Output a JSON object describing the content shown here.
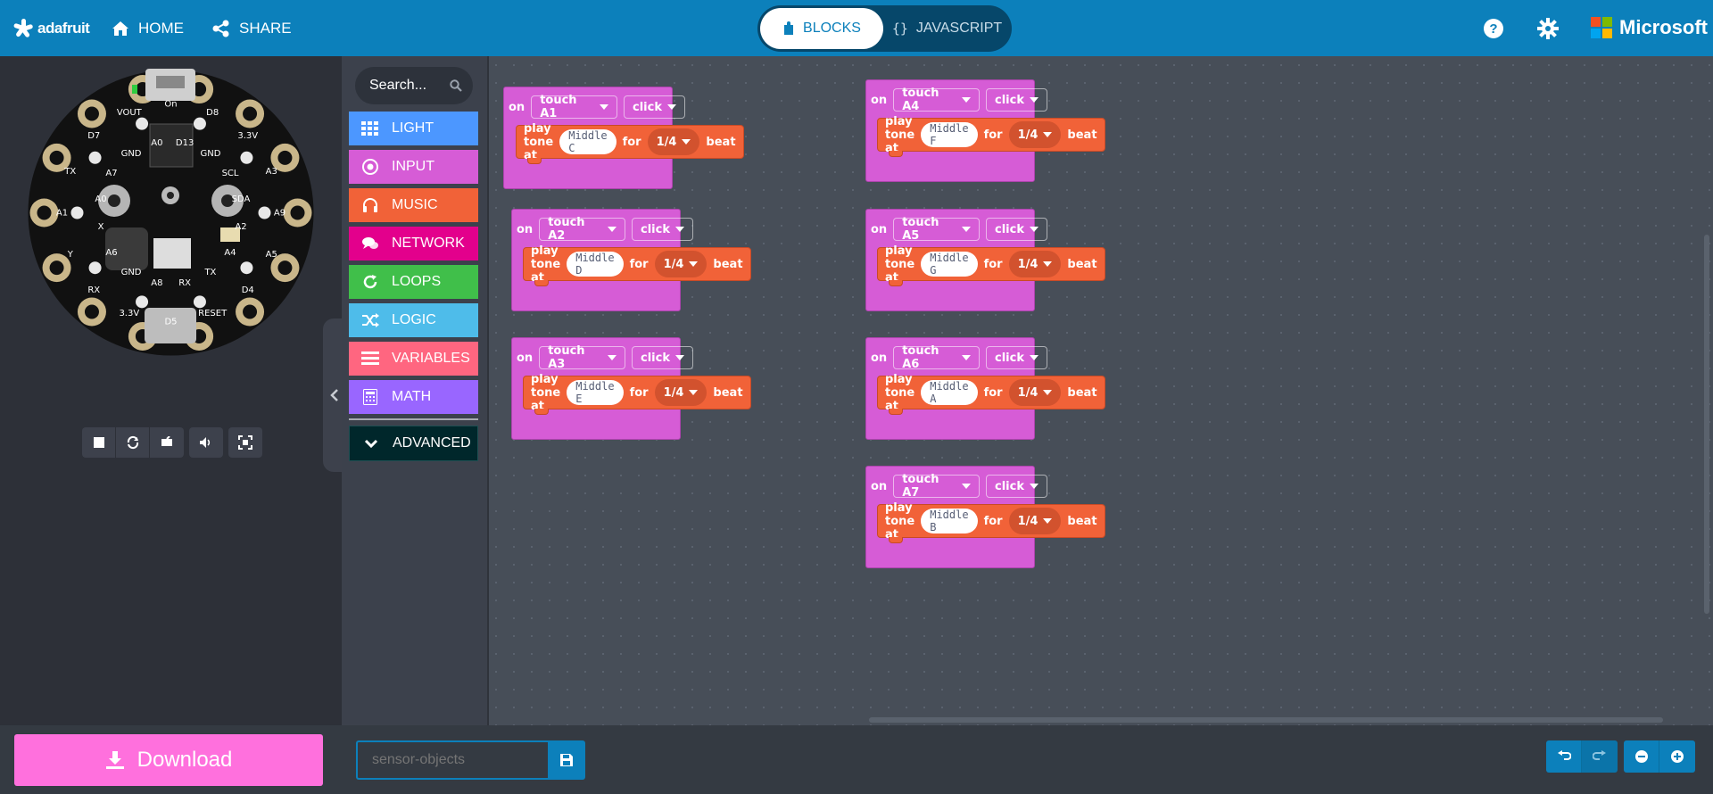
{
  "header": {
    "brand": "adafruit",
    "home_label": "HOME",
    "share_label": "SHARE",
    "blocks_label": "BLOCKS",
    "javascript_label": "JAVASCRIPT",
    "microsoft_label": "Microsoft",
    "accent_color": "#0c80bb"
  },
  "simulator": {
    "board_labels": [
      "On",
      "D13",
      "D8",
      "GND",
      "3.3V",
      "SCL",
      "A3",
      "SDA",
      "A9",
      "A2",
      "A5",
      "A4",
      "D4",
      "TX",
      "RESET",
      "RX",
      "D5",
      "A8",
      "3.3V",
      "GND",
      "RX",
      "A6",
      "Y",
      "X",
      "A1",
      "A0",
      "TX",
      "A7",
      "D7",
      "GND",
      "VOUT",
      "A0"
    ],
    "controls": [
      "stop-icon",
      "restart-icon",
      "debug-icon",
      "mute-icon",
      "fullscreen-icon"
    ]
  },
  "toolbox": {
    "search_placeholder": "Search...",
    "categories": [
      {
        "label": "LIGHT",
        "color": "#4c97ff",
        "icon": "grid-icon"
      },
      {
        "label": "INPUT",
        "color": "#d65cd6",
        "icon": "target-icon"
      },
      {
        "label": "MUSIC",
        "color": "#f16238",
        "icon": "headphones-icon"
      },
      {
        "label": "NETWORK",
        "color": "#e3008c",
        "icon": "chat-icon"
      },
      {
        "label": "LOOPS",
        "color": "#40bf4a",
        "icon": "refresh-icon"
      },
      {
        "label": "LOGIC",
        "color": "#4ebcea",
        "icon": "shuffle-icon"
      },
      {
        "label": "VARIABLES",
        "color": "#ff6680",
        "icon": "list-icon"
      },
      {
        "label": "MATH",
        "color": "#9966ff",
        "icon": "calculator-icon"
      }
    ],
    "advanced_label": "ADVANCED",
    "advanced_color": "#00272b"
  },
  "workspace": {
    "blocks": [
      {
        "on": "on",
        "event": "touch A1",
        "action": "click",
        "play": "play tone at",
        "note": "Middle C",
        "for": "for",
        "beat": "1/4",
        "beat_label": "beat"
      },
      {
        "on": "on",
        "event": "touch A2",
        "action": "click",
        "play": "play tone at",
        "note": "Middle D",
        "for": "for",
        "beat": "1/4",
        "beat_label": "beat"
      },
      {
        "on": "on",
        "event": "touch A3",
        "action": "click",
        "play": "play tone at",
        "note": "Middle E",
        "for": "for",
        "beat": "1/4",
        "beat_label": "beat"
      },
      {
        "on": "on",
        "event": "touch A4",
        "action": "click",
        "play": "play tone at",
        "note": "Middle F",
        "for": "for",
        "beat": "1/4",
        "beat_label": "beat"
      },
      {
        "on": "on",
        "event": "touch A5",
        "action": "click",
        "play": "play tone at",
        "note": "Middle G",
        "for": "for",
        "beat": "1/4",
        "beat_label": "beat"
      },
      {
        "on": "on",
        "event": "touch A6",
        "action": "click",
        "play": "play tone at",
        "note": "Middle A",
        "for": "for",
        "beat": "1/4",
        "beat_label": "beat"
      },
      {
        "on": "on",
        "event": "touch A7",
        "action": "click",
        "play": "play tone at",
        "note": "Middle B",
        "for": "for",
        "beat": "1/4",
        "beat_label": "beat"
      }
    ]
  },
  "footer": {
    "download_label": "Download",
    "project_name_value": "",
    "project_name_placeholder": "sensor-objects"
  }
}
